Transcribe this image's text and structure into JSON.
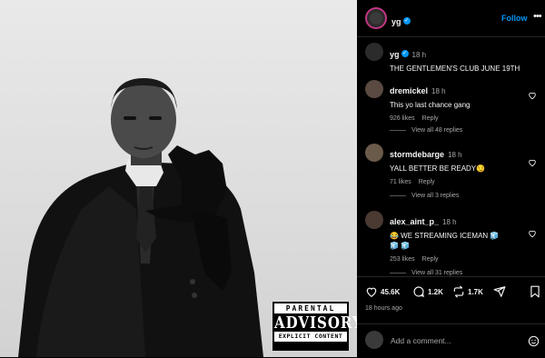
{
  "post": {
    "author": "yg",
    "follow_label": "Follow",
    "more_label": "•••",
    "caption_time": "18 h",
    "caption_text": "THE GENTLEMEN'S CLUB JUNE 19TH",
    "advisory": {
      "top": "PARENTAL",
      "middle": "ADVISORY",
      "bottom": "EXPLICIT CONTENT"
    }
  },
  "comments": [
    {
      "user": "dremickel",
      "time": "18 h",
      "text": "This yo last chance gang",
      "likes": "926 likes",
      "reply": "Reply",
      "view_replies": "View all 48 replies"
    },
    {
      "user": "stormdebarge",
      "time": "18 h",
      "text": "YALL BETTER BE READY😏",
      "likes": "71 likes",
      "reply": "Reply",
      "view_replies": "View all 3 replies"
    },
    {
      "user": "alex_aint_p_",
      "time": "18 h",
      "text": "😂 WE STREAMING ICEMAN 🧊",
      "text2": "🧊 🧊",
      "likes": "253 likes",
      "reply": "Reply",
      "view_replies": "View all 31 replies"
    }
  ],
  "actions": {
    "likes": "45.6K",
    "comments": "1.2K",
    "reposts": "1.7K"
  },
  "post_time": "18 hours ago",
  "add_comment": {
    "placeholder": "Add a comment..."
  },
  "colors": {
    "accent": "#0095f6",
    "background": "#000000",
    "muted": "#a8a8a8"
  },
  "icons": [
    "heart-icon",
    "comment-icon",
    "repost-icon",
    "share-icon",
    "bookmark-icon",
    "emoji-icon",
    "verified-icon",
    "more-icon"
  ]
}
